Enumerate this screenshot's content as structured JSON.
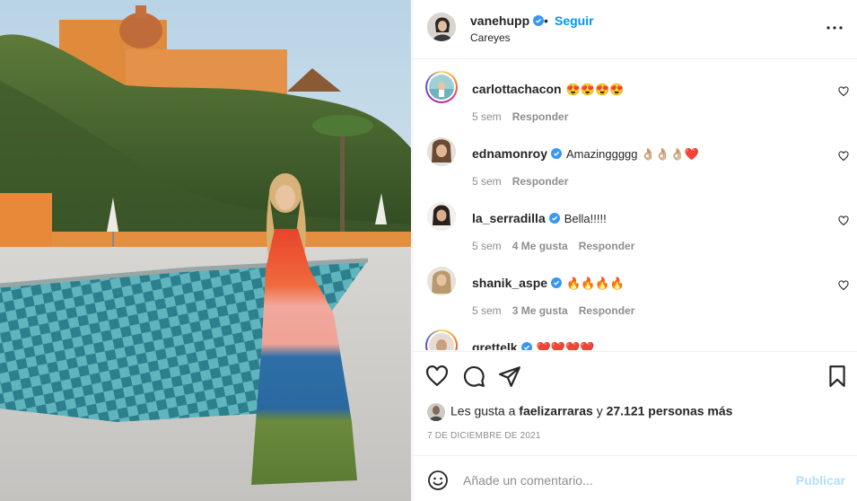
{
  "post": {
    "username": "vanehupp",
    "separator": "•",
    "follow_label": "Seguir",
    "location": "Careyes",
    "more_icon": "more-horizontal-icon"
  },
  "comments": [
    {
      "username": "carlottachacon",
      "verified": false,
      "text": "😍😍😍😍",
      "time": "5 sem",
      "likes": "",
      "reply": "Responder"
    },
    {
      "username": "ednamonroy",
      "verified": true,
      "text": "Amazinggggg 👌🏼👌🏼👌🏼❤️",
      "time": "5 sem",
      "likes": "",
      "reply": "Responder"
    },
    {
      "username": "la_serradilla",
      "verified": true,
      "text": "Bella!!!!!",
      "time": "5 sem",
      "likes": "4 Me gusta",
      "reply": "Responder"
    },
    {
      "username": "shanik_aspe",
      "verified": true,
      "text": "🔥🔥🔥🔥",
      "time": "5 sem",
      "likes": "3 Me gusta",
      "reply": "Responder"
    },
    {
      "username": "grettelk",
      "verified": true,
      "text": "❤️❤️❤️❤️",
      "time": "",
      "likes": "",
      "reply": ""
    }
  ],
  "actions": {
    "like_icon": "heart-icon",
    "comment_icon": "comment-icon",
    "share_icon": "send-icon",
    "save_icon": "bookmark-icon"
  },
  "likes": {
    "prefix": "Les gusta a",
    "liker": "faelizarraras",
    "middle": "y",
    "count": "27.121 personas más"
  },
  "date": "7 DE DICIEMBRE DE 2021",
  "add_comment": {
    "placeholder": "Añade un comentario...",
    "publish_label": "Publicar"
  },
  "colors": {
    "accent": "#0095f6",
    "publish_disabled": "#b2dffc",
    "muted": "#8e8e8e",
    "text": "#262626"
  }
}
